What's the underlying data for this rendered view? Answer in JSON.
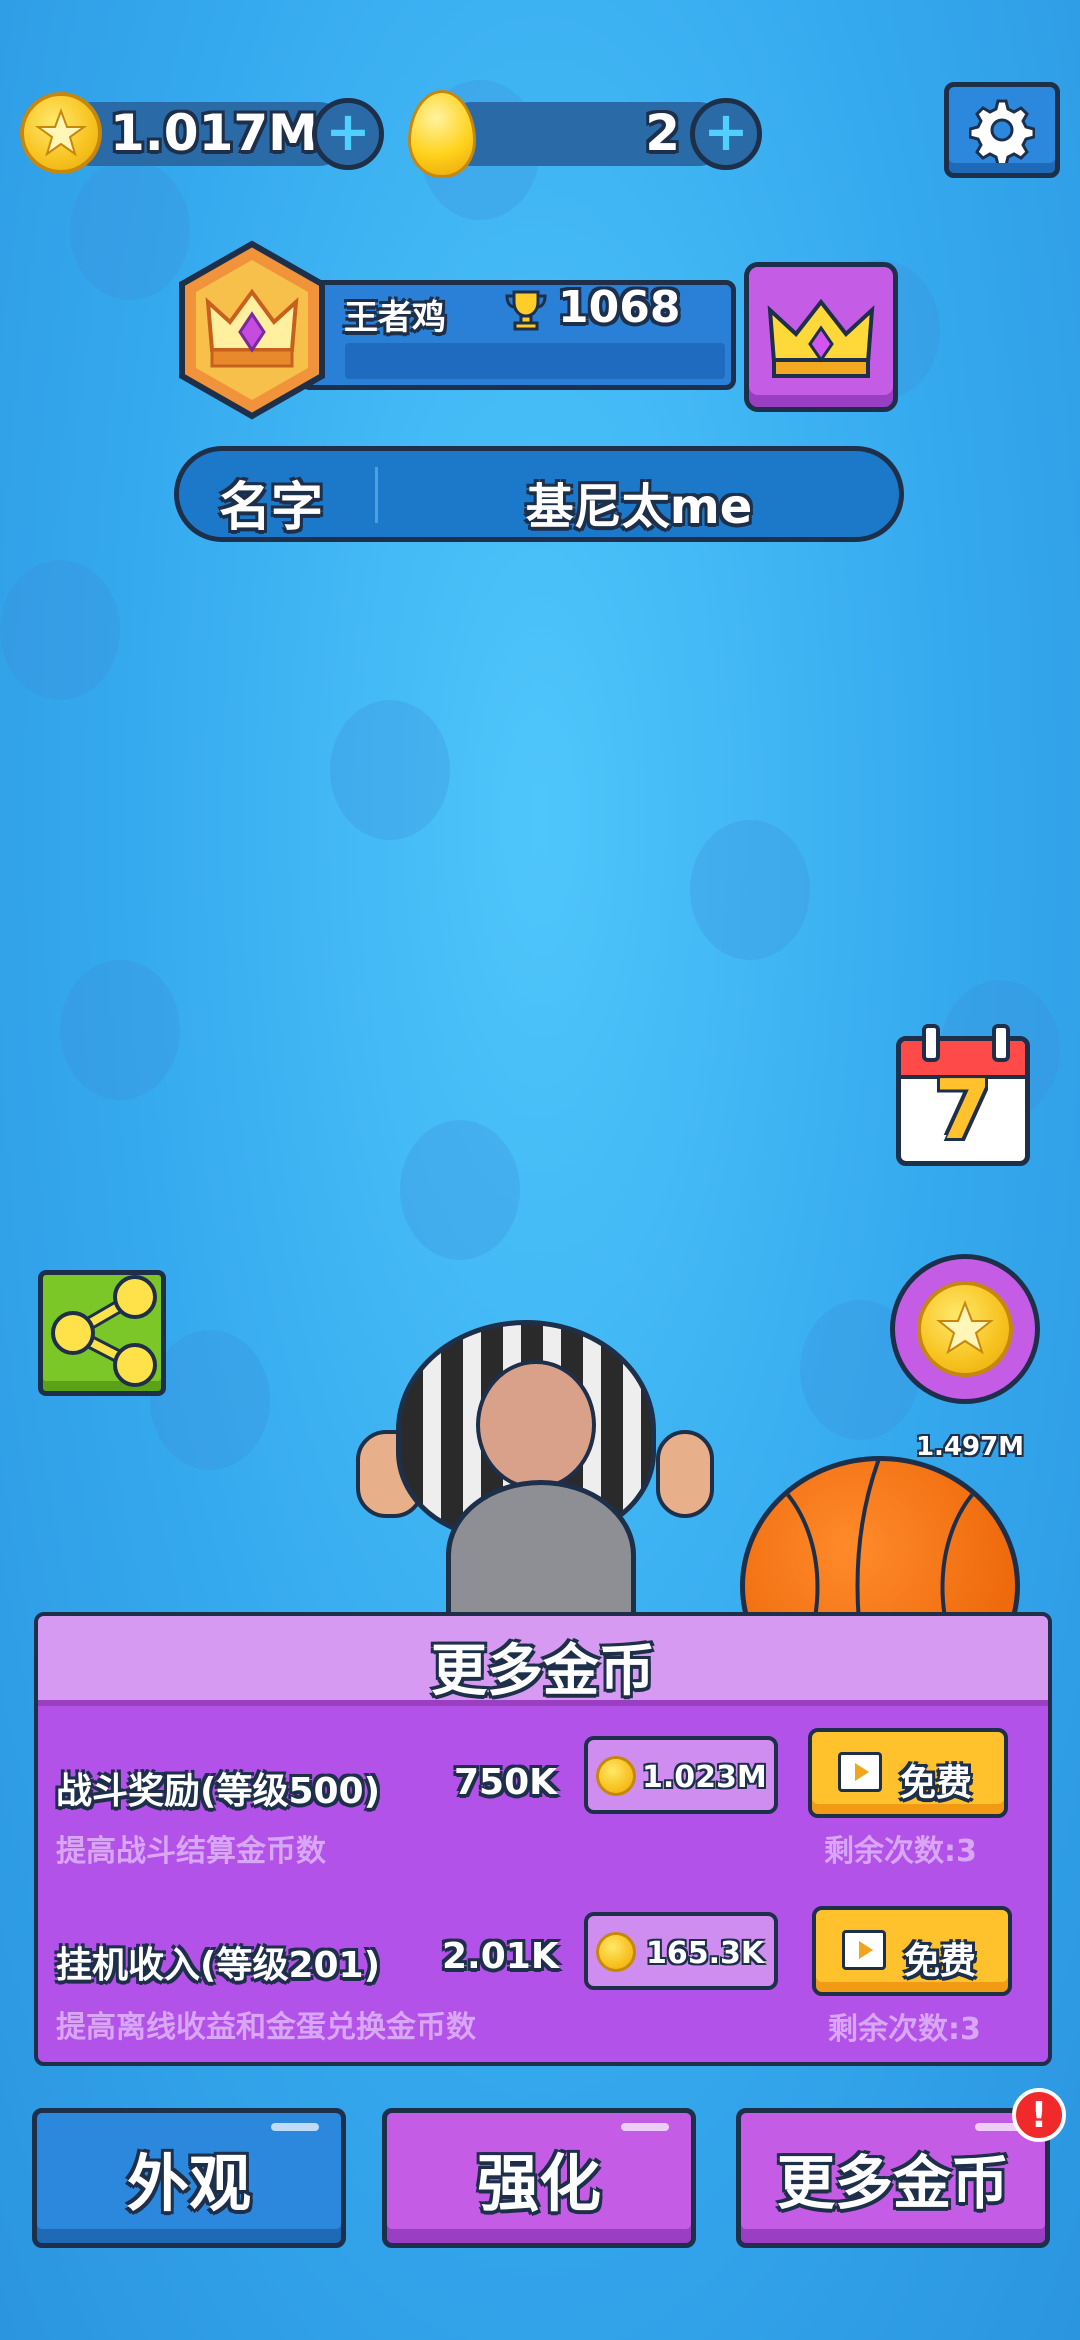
{
  "currency": {
    "coins": "1.017M",
    "eggs": "2"
  },
  "player": {
    "rank_name": "王者鸡",
    "trophies": "1068",
    "name_label": "名字",
    "name_value": "基尼太me"
  },
  "side": {
    "calendar_day": "7",
    "coin_reward": "1.497M"
  },
  "panel": {
    "title": "更多金币",
    "rows": [
      {
        "title": "战斗奖励(等级500)",
        "value": "750K",
        "cost": "1.023M",
        "free_label": "免费",
        "desc": "提高战斗结算金币数",
        "remaining": "剩余次数:3"
      },
      {
        "title": "挂机收入(等级201)",
        "value": "2.01K",
        "cost": "165.3K",
        "free_label": "免费",
        "desc": "提高离线收益和金蛋兑换金币数",
        "remaining": "剩余次数:3"
      }
    ]
  },
  "tabs": [
    {
      "label": "外观",
      "color": "#2b88dd"
    },
    {
      "label": "强化",
      "color": "#c45ce6"
    },
    {
      "label": "更多金币",
      "color": "#c45ce6",
      "badge": "!"
    }
  ],
  "colors": {
    "sky": "#35a9ee",
    "purple": "#b252e8",
    "gold": "#ffc22d",
    "outline": "#1e2f4a"
  }
}
